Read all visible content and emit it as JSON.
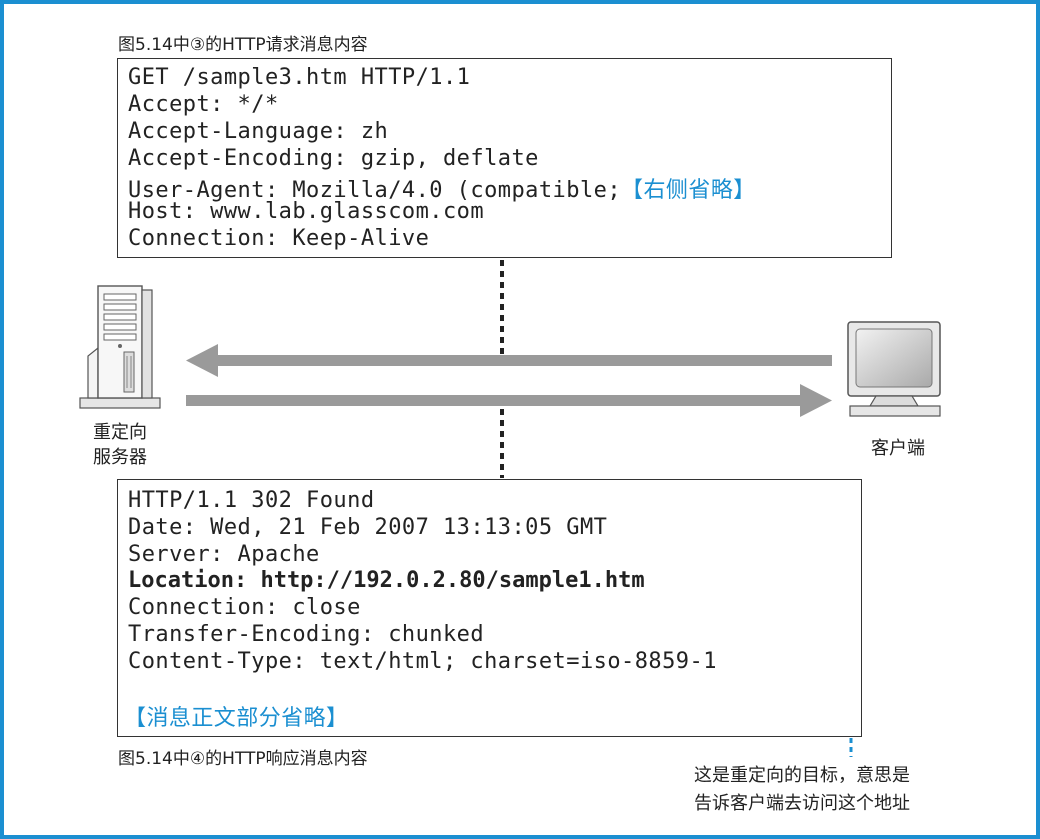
{
  "request": {
    "caption": "图5.14中③的HTTP请求消息内容",
    "lines": [
      "GET /sample3.htm HTTP/1.1",
      "Accept: */*",
      "Accept-Language: zh",
      "Accept-Encoding: gzip, deflate",
      "User-Agent: Mozilla/4.0 (compatible;",
      "Host: www.lab.glasscom.com",
      "Connection: Keep-Alive"
    ],
    "omitted_note": "【右侧省略】"
  },
  "response": {
    "caption": "图5.14中④的HTTP响应消息内容",
    "lines": [
      "HTTP/1.1 302 Found",
      "Date: Wed, 21 Feb 2007 13:13:05 GMT",
      "Server: Apache",
      "Location: http://192.0.2.80/sample1.htm",
      "Connection: close",
      "Transfer-Encoding: chunked",
      "Content-Type: text/html; charset=iso-8859-1"
    ],
    "body_note": "【消息正文部分省略】"
  },
  "server": {
    "label_line1": "重定向",
    "label_line2": "服务器"
  },
  "client": {
    "label": "客户端"
  },
  "annotation": {
    "line1": "这是重定向的目标，意思是",
    "line2": "告诉客户端去访问这个地址"
  },
  "colors": {
    "frame": "#1b8fd1",
    "accent": "#1b8fd1",
    "arrow": "#9a9a9a",
    "text": "#222222"
  }
}
